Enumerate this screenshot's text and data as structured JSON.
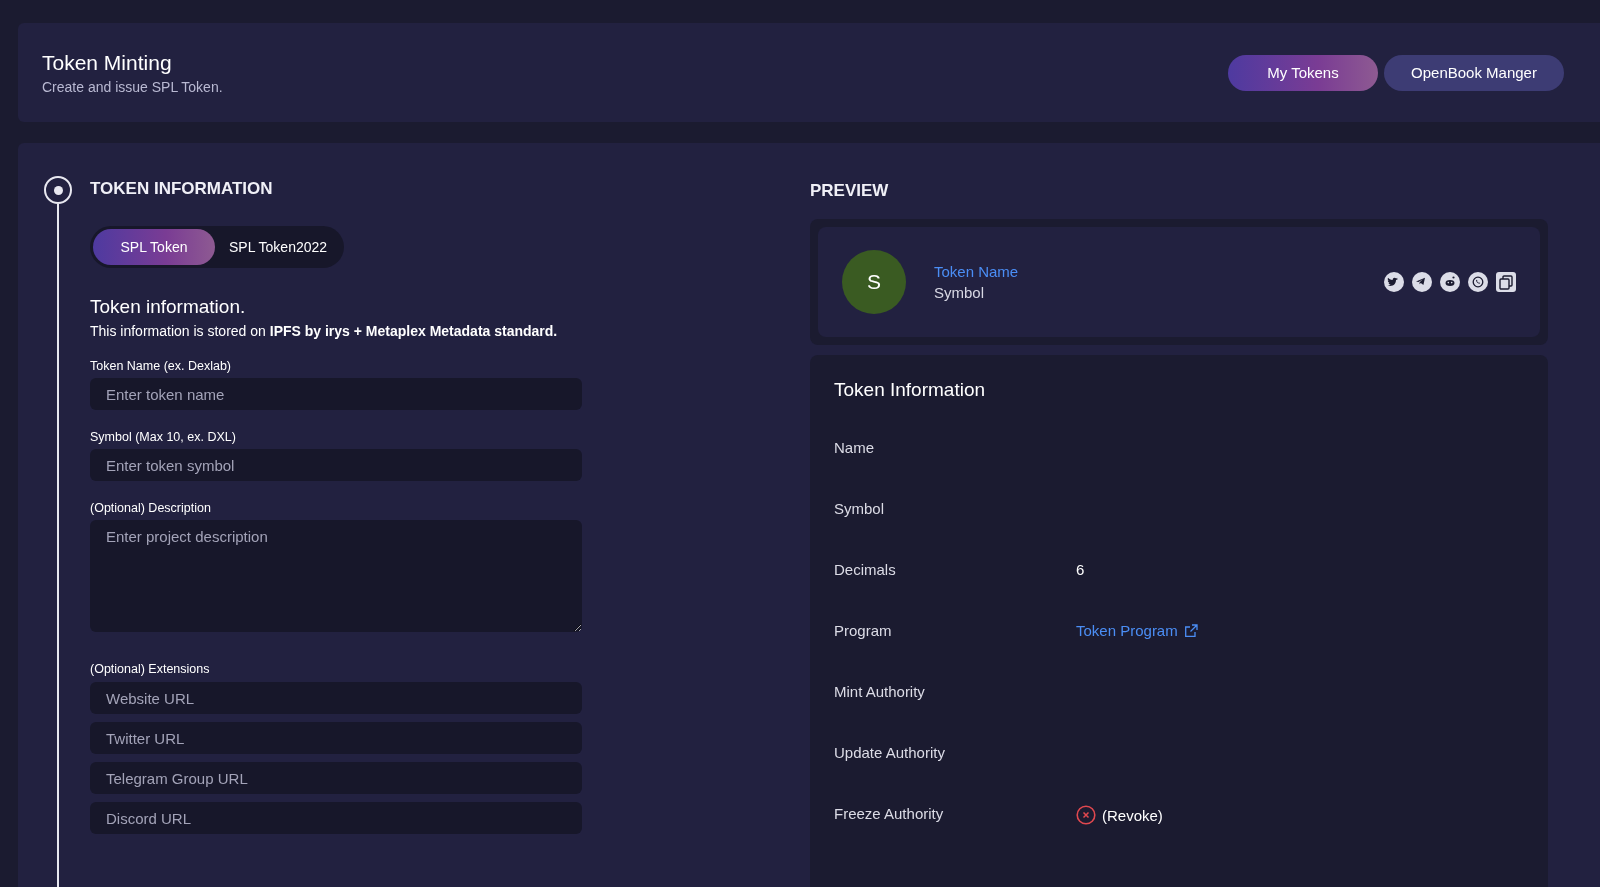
{
  "header": {
    "title": "Token Minting",
    "subtitle": "Create and issue SPL Token.",
    "buttons": [
      {
        "label": "My Tokens",
        "kind": "primary"
      },
      {
        "label": "OpenBook Manger",
        "kind": "secondary"
      }
    ]
  },
  "form": {
    "step_title": "TOKEN INFORMATION",
    "tabs": [
      {
        "label": "SPL Token",
        "selected": true
      },
      {
        "label": "SPL Token2022",
        "selected": false
      }
    ],
    "section_title": "Token information.",
    "section_note": "This information is stored on **IPFS by irys + Metaplex Metadata standard.**",
    "fields": [
      {
        "label": "Token Name (ex. Dexlab)",
        "placeholder": "Enter token name",
        "kind": "input"
      },
      {
        "label": "Symbol (Max 10, ex. DXL)",
        "placeholder": "Enter token symbol",
        "kind": "input"
      },
      {
        "label": "(Optional) Description",
        "placeholder": "Enter project description",
        "kind": "textarea"
      }
    ],
    "extensions_label": "(Optional) Extensions",
    "extensions": [
      {
        "placeholder": "Website URL"
      },
      {
        "placeholder": "Twitter URL"
      },
      {
        "placeholder": "Telegram Group URL"
      },
      {
        "placeholder": "Discord URL"
      }
    ]
  },
  "preview": {
    "title": "PREVIEW",
    "avatar_letter": "S",
    "token_name": "Token Name",
    "symbol": "Symbol",
    "info_title": "Token Information",
    "rows": [
      {
        "label": "Name",
        "kind": "empty"
      },
      {
        "label": "Symbol",
        "kind": "empty"
      },
      {
        "label": "Decimals",
        "kind": "text",
        "value": "6"
      },
      {
        "label": "Program",
        "kind": "link",
        "value": "Token Program"
      },
      {
        "label": "Mint Authority",
        "kind": "empty"
      },
      {
        "label": "Update Authority",
        "kind": "empty"
      },
      {
        "label": "Freeze Authority",
        "kind": "revoke",
        "value": "(Revoke)"
      }
    ]
  }
}
